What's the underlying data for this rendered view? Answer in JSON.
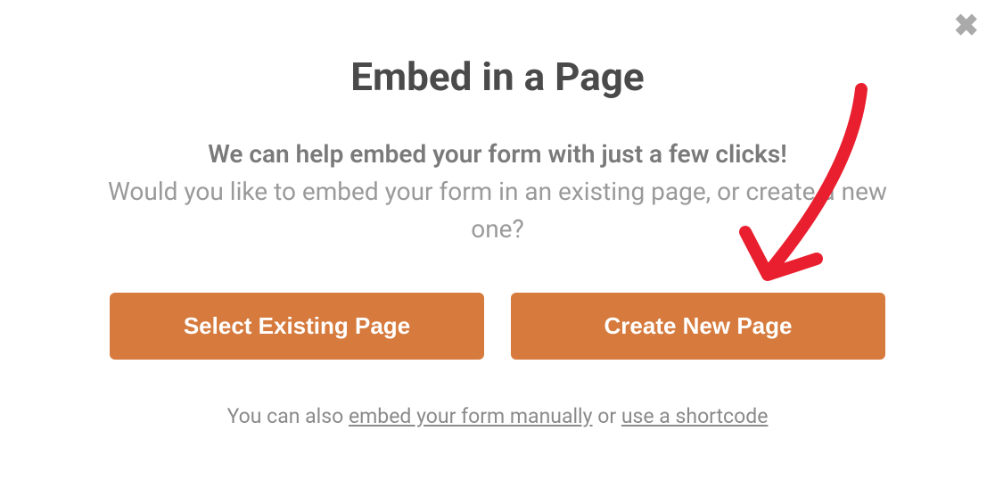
{
  "modal": {
    "title": "Embed in a Page",
    "subtitle_bold": "We can help embed your form with just a few clicks!",
    "subtitle_light": "Would you like to embed your form in an existing page, or create a new one?",
    "buttons": {
      "select_existing": "Select Existing Page",
      "create_new": "Create New Page"
    },
    "footer": {
      "prefix": "You can also ",
      "link_manual": "embed your form manually",
      "middle": " or ",
      "link_shortcode": "use a shortcode"
    }
  },
  "colors": {
    "accent": "#d67a3d"
  }
}
